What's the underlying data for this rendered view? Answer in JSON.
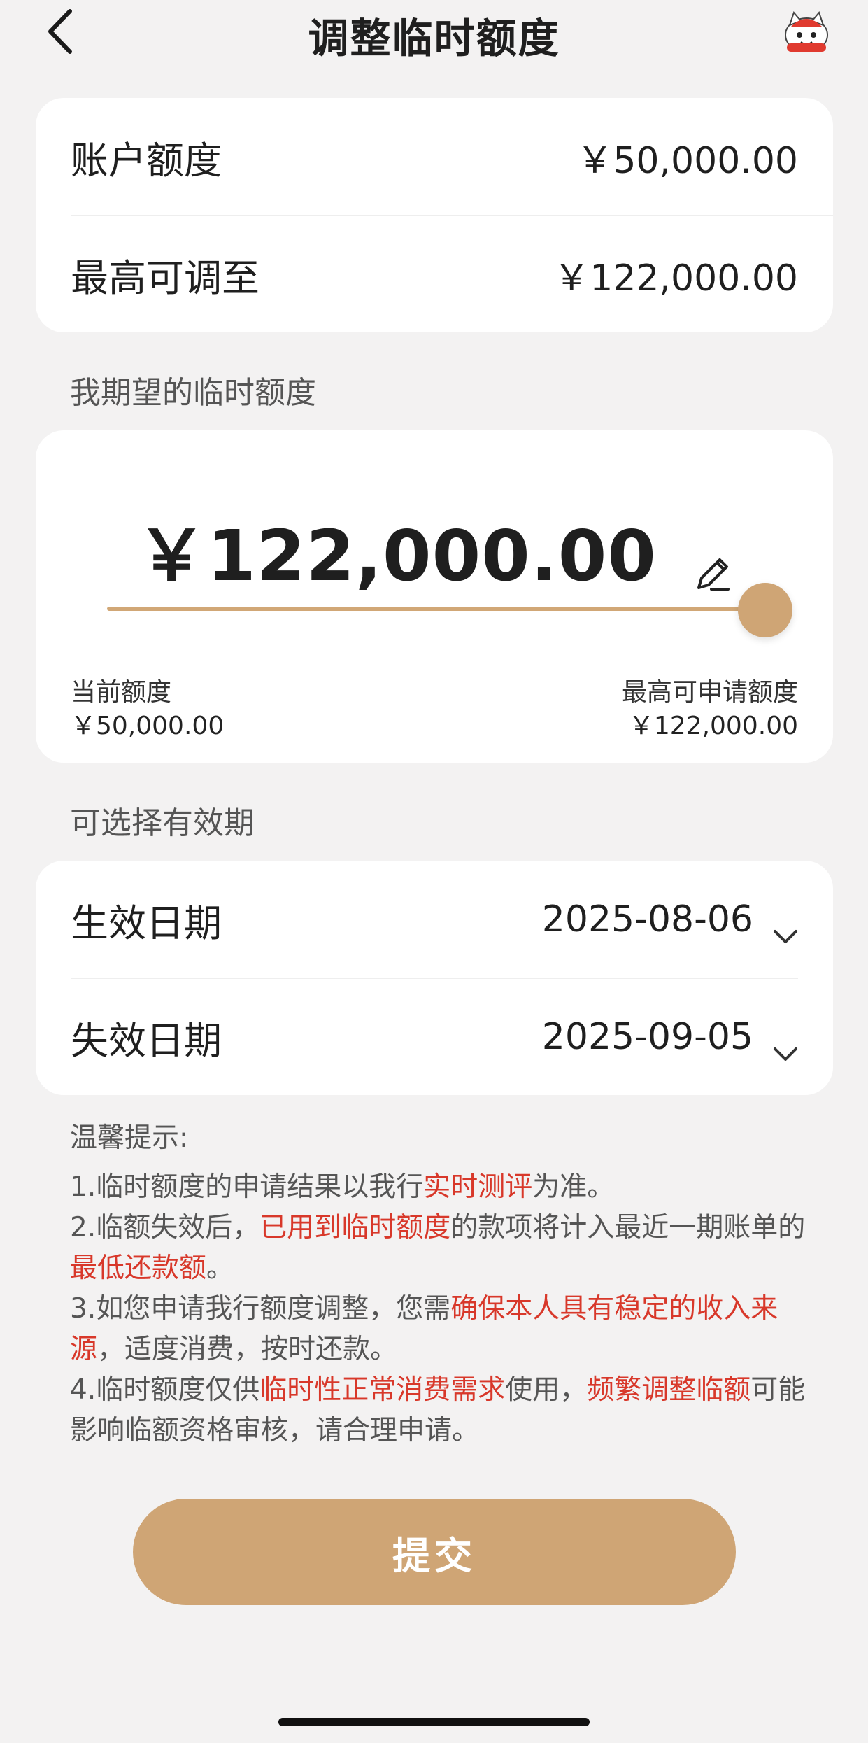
{
  "header": {
    "title": "调整临时额度",
    "back_icon": "chevron-left-icon",
    "mascot_icon": "mascot-icon"
  },
  "summary": {
    "account_limit_label": "账户额度",
    "account_limit_value": "￥50,000.00",
    "max_adjust_label": "最高可调至",
    "max_adjust_value": "￥122,000.00"
  },
  "expected": {
    "section_label": "我期望的临时额度",
    "amount": "￥122,000.00",
    "slider_level": 1.0,
    "current_label": "当前额度",
    "current_value": "￥50,000.00",
    "max_label": "最高可申请额度",
    "max_value": "￥122,000.00"
  },
  "period": {
    "section_label": "可选择有效期",
    "effective_label": "生效日期",
    "effective_value": "2025-08-06",
    "expiry_label": "失效日期",
    "expiry_value": "2025-09-05"
  },
  "tips": {
    "title": "温馨提示:",
    "t1_a": "1.临时额度的申请结果以我行",
    "t1_hl": "实时测评",
    "t1_b": "为准。",
    "t2_a": "2.临额失效后，",
    "t2_hl1": "已用到临时额度",
    "t2_b": "的款项将计入最近一期账单的",
    "t2_hl2": "最低还款额",
    "t2_c": "。",
    "t3_a": "3.如您申请我行额度调整，您需",
    "t3_hl": "确保本人具有稳定的收入来源",
    "t3_b": "，适度消费，按时还款。",
    "t4_a": "4.临时额度仅供",
    "t4_hl1": "临时性正常消费需求",
    "t4_b": "使用，",
    "t4_hl2": "频繁调整临额",
    "t4_c": "可能影响临额资格审核，请合理申请。"
  },
  "submit_label": "提交",
  "colors": {
    "accent": "#cfa575",
    "highlight": "#d8382a",
    "background": "#f3f2f2"
  }
}
